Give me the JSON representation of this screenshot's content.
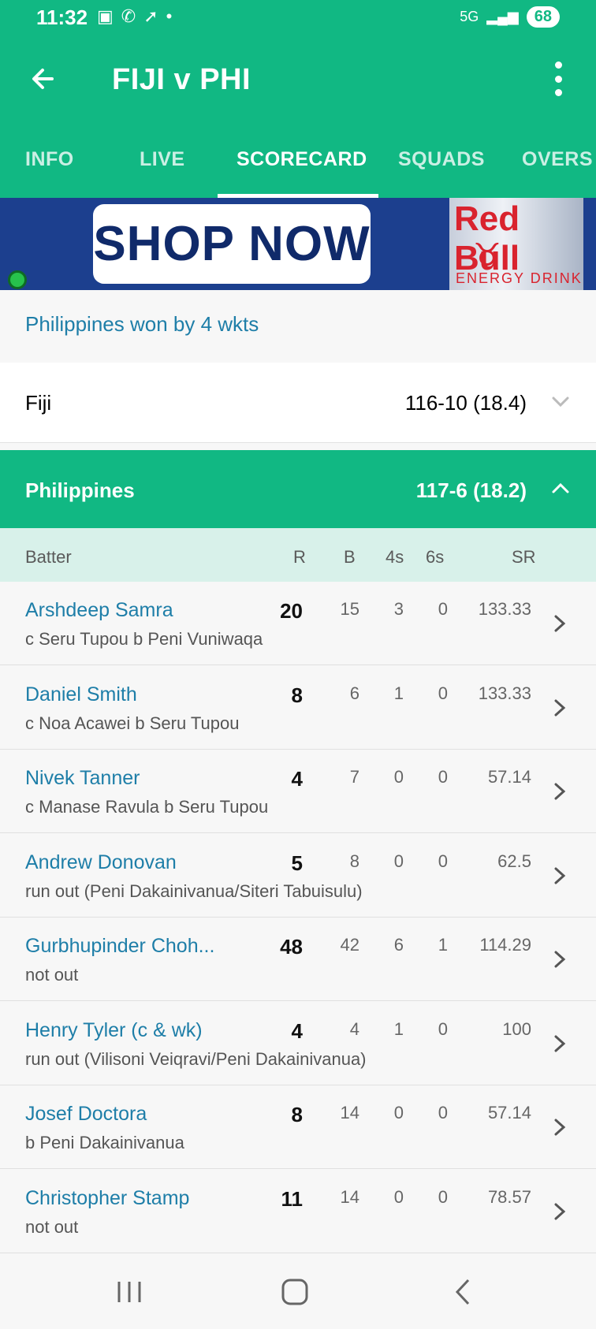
{
  "status_bar": {
    "time": "11:32",
    "network": "5G",
    "battery": "68"
  },
  "toolbar": {
    "title": "FIJI v PHI"
  },
  "tabs": [
    {
      "label": "INFO"
    },
    {
      "label": "LIVE"
    },
    {
      "label": "SCORECARD"
    },
    {
      "label": "SQUADS"
    },
    {
      "label": "OVERS"
    }
  ],
  "ad": {
    "button": "SHOP NOW",
    "brand": "Red Bull",
    "tagline": "ENERGY DRINK"
  },
  "result": "Philippines won by 4 wkts",
  "innings": [
    {
      "team": "Fiji",
      "score": "116-10 (18.4)"
    },
    {
      "team": "Philippines",
      "score": "117-6 (18.2)"
    }
  ],
  "table_header": {
    "batter": "Batter",
    "r": "R",
    "b": "B",
    "fours": "4s",
    "sixes": "6s",
    "sr": "SR"
  },
  "batters": [
    {
      "name": "Arshdeep Samra",
      "dismissal": "c Seru Tupou b Peni Vuniwaqa",
      "r": "20",
      "b": "15",
      "fours": "3",
      "sixes": "0",
      "sr": "133.33"
    },
    {
      "name": "Daniel Smith",
      "dismissal": "c Noa Acawei b Seru Tupou",
      "r": "8",
      "b": "6",
      "fours": "1",
      "sixes": "0",
      "sr": "133.33"
    },
    {
      "name": "Nivek Tanner",
      "dismissal": "c Manase Ravula b Seru Tupou",
      "r": "4",
      "b": "7",
      "fours": "0",
      "sixes": "0",
      "sr": "57.14"
    },
    {
      "name": "Andrew Donovan",
      "dismissal": "run out (Peni Dakainivanua/Siteri Tabuisulu)",
      "r": "5",
      "b": "8",
      "fours": "0",
      "sixes": "0",
      "sr": "62.5"
    },
    {
      "name": "Gurbhupinder Choh...",
      "dismissal": "not out",
      "r": "48",
      "b": "42",
      "fours": "6",
      "sixes": "1",
      "sr": "114.29"
    },
    {
      "name": "Henry Tyler (c & wk)",
      "dismissal": "run out (Vilisoni Veiqravi/Peni Dakainivanua)",
      "r": "4",
      "b": "4",
      "fours": "1",
      "sixes": "0",
      "sr": "100"
    },
    {
      "name": "Josef Doctora",
      "dismissal": "b Peni Dakainivanua",
      "r": "8",
      "b": "14",
      "fours": "0",
      "sixes": "0",
      "sr": "57.14"
    },
    {
      "name": "Christopher Stamp",
      "dismissal": "not out",
      "r": "11",
      "b": "14",
      "fours": "0",
      "sixes": "0",
      "sr": "78.57"
    }
  ],
  "colors": {
    "primary": "#11b883",
    "link": "#1e7ea8",
    "header_row": "#d8f1ea"
  }
}
